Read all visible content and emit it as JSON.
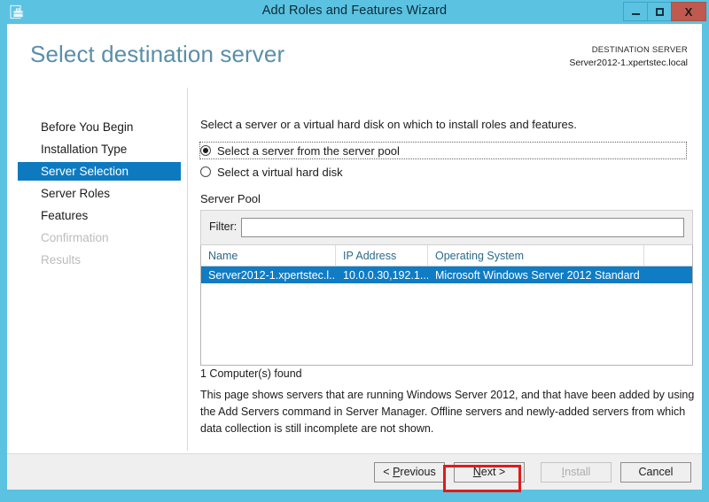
{
  "window": {
    "title": "Add Roles and Features Wizard",
    "icon": "server-toolbox-icon",
    "minimize_label": "–",
    "maximize_label": "□",
    "close_label": "X",
    "frame_color": "#5bc2e1",
    "close_color": "#c0594e"
  },
  "header": {
    "page_title": "Select destination server",
    "destination_label": "DESTINATION SERVER",
    "destination_value": "Server2012-1.xpertstec.local",
    "title_color": "#5a8fa8"
  },
  "sidebar": {
    "active_color": "#0d7ac0",
    "items": [
      {
        "label": "Before You Begin",
        "state": "normal"
      },
      {
        "label": "Installation Type",
        "state": "normal"
      },
      {
        "label": "Server Selection",
        "state": "active"
      },
      {
        "label": "Server Roles",
        "state": "normal"
      },
      {
        "label": "Features",
        "state": "normal"
      },
      {
        "label": "Confirmation",
        "state": "disabled"
      },
      {
        "label": "Results",
        "state": "disabled"
      }
    ]
  },
  "main": {
    "intro": "Select a server or a virtual hard disk on which to install roles and features.",
    "radios": [
      {
        "label": "Select a server from the server pool",
        "checked": true,
        "focused": true
      },
      {
        "label": "Select a virtual hard disk",
        "checked": false,
        "focused": false
      }
    ],
    "section_label": "Server Pool",
    "filter": {
      "label": "Filter:",
      "value": "",
      "placeholder": ""
    },
    "table": {
      "columns": [
        "Name",
        "IP Address",
        "Operating System",
        ""
      ],
      "rows": [
        {
          "name": "Server2012-1.xpertstec.l...",
          "ip": "10.0.0.30,192.1...",
          "os": "Microsoft Windows Server 2012 Standard",
          "extra": "",
          "selected": true
        }
      ],
      "selection_color": "#0f7cc4",
      "header_text_color": "#2b6a8a"
    },
    "found_text": "1 Computer(s) found",
    "help_text": "This page shows servers that are running Windows Server 2012, and that have been added by using the Add Servers command in Server Manager. Offline servers and newly-added servers from which data collection is still incomplete are not shown."
  },
  "footer": {
    "buttons": [
      {
        "label": "< Previous",
        "accel": "P",
        "enabled": true,
        "highlighted": false
      },
      {
        "label": "Next >",
        "accel": "N",
        "enabled": true,
        "highlighted": true
      },
      {
        "label": "Install",
        "accel": "I",
        "enabled": false,
        "highlighted": false
      },
      {
        "label": "Cancel",
        "accel": "",
        "enabled": true,
        "highlighted": false
      }
    ],
    "highlight_color": "#e01b1b"
  }
}
